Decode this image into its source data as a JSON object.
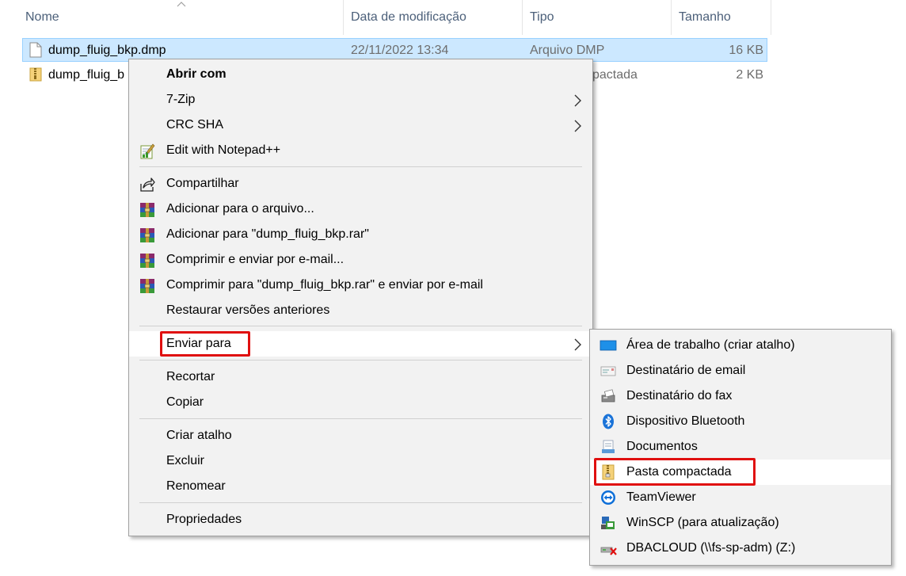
{
  "columns": {
    "name": "Nome",
    "modified": "Data de modificação",
    "type": "Tipo",
    "size": "Tamanho"
  },
  "files": [
    {
      "name": "dump_fluig_bkp.dmp",
      "modified": "22/11/2022 13:34",
      "type": "Arquivo DMP",
      "size": "16 KB",
      "icon": "document-icon"
    },
    {
      "name": "dump_fluig_b",
      "modified": "",
      "type": "pactada",
      "size": "2 KB",
      "icon": "zip-folder-icon"
    }
  ],
  "context_menu": {
    "open_with": "Abrir com",
    "seven_zip": "7-Zip",
    "crc_sha": "CRC SHA",
    "notepad": "Edit with Notepad++",
    "share": "Compartilhar",
    "add_archive": "Adicionar para o arquivo...",
    "add_rar": "Adicionar para \"dump_fluig_bkp.rar\"",
    "compress_email": "Comprimir e enviar por e-mail...",
    "compress_rar_email": "Comprimir para \"dump_fluig_bkp.rar\" e enviar por e-mail",
    "restore": "Restaurar versões anteriores",
    "send_to": "Enviar para",
    "cut": "Recortar",
    "copy": "Copiar",
    "shortcut": "Criar atalho",
    "delete": "Excluir",
    "rename": "Renomear",
    "properties": "Propriedades"
  },
  "send_to_menu": {
    "desktop": "Área de trabalho (criar atalho)",
    "mail": "Destinatário de email",
    "fax": "Destinatário do fax",
    "bluetooth": "Dispositivo Bluetooth",
    "documents": "Documentos",
    "zip": "Pasta compactada",
    "teamviewer": "TeamViewer",
    "winscp": "WinSCP (para atualização)",
    "dbacloud": "DBACLOUD (\\\\fs-sp-adm) (Z:)"
  },
  "colors": {
    "selection": "#cce8ff",
    "highlight_box": "#e01010",
    "menu_bg": "#f2f2f2"
  }
}
